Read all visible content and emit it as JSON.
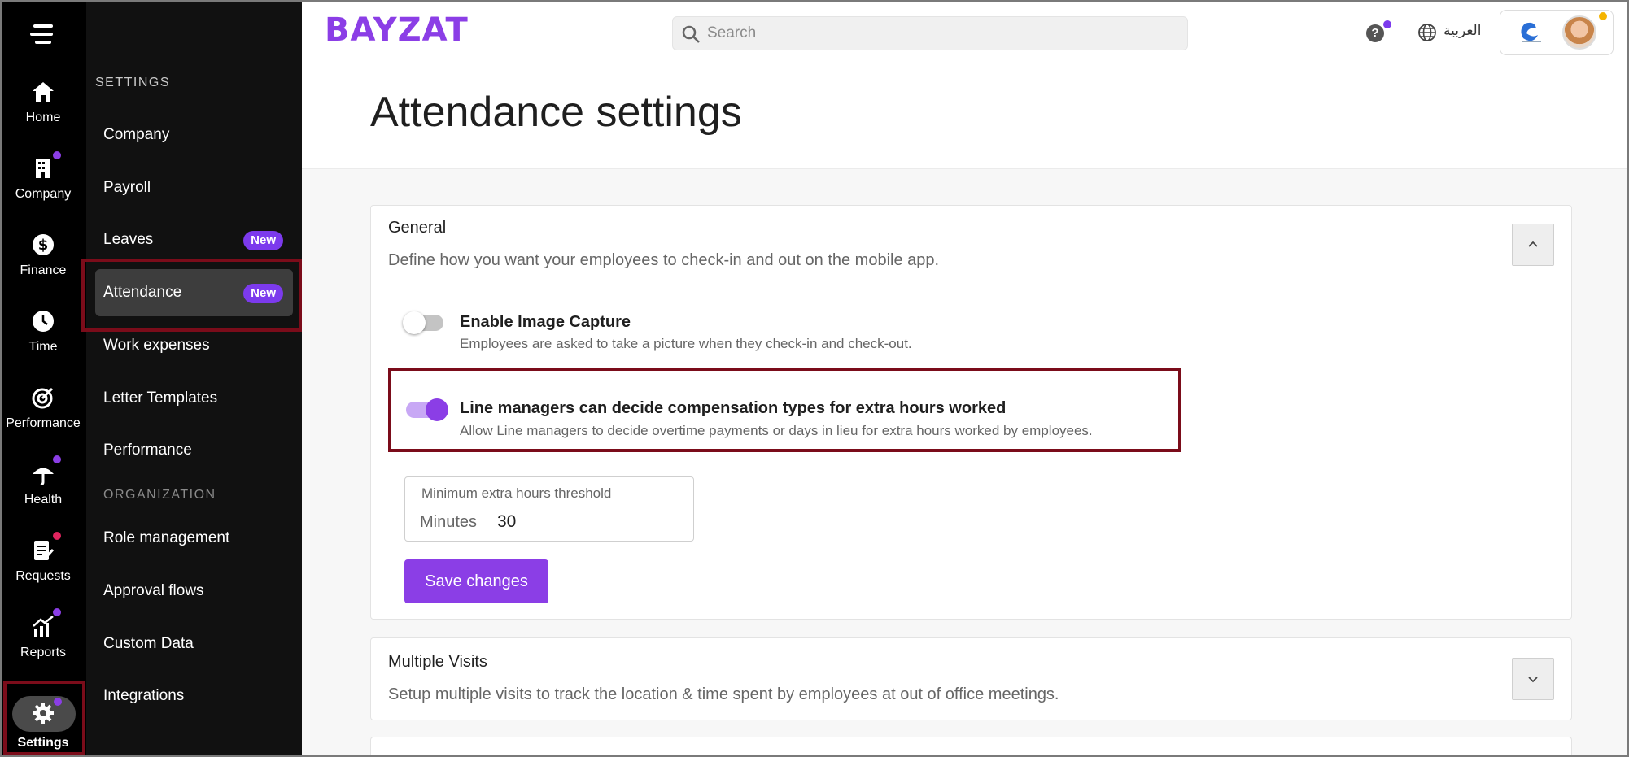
{
  "app": {
    "logo": "BAYZAT"
  },
  "colors": {
    "accent": "#8b3ee6",
    "highlight": "#7b0c1a",
    "rail_bg": "#000000",
    "submenu_bg": "#111111",
    "badge": "#7c3aed"
  },
  "rail": {
    "menu_icon": "hamburger-icon",
    "items": [
      {
        "label": "Home",
        "icon": "home-icon"
      },
      {
        "label": "Company",
        "icon": "building-icon"
      },
      {
        "label": "Finance",
        "icon": "dollar-icon"
      },
      {
        "label": "Time",
        "icon": "clock-icon"
      },
      {
        "label": "Performance",
        "icon": "target-icon"
      },
      {
        "label": "Health",
        "icon": "umbrella-icon"
      },
      {
        "label": "Requests",
        "icon": "request-icon"
      },
      {
        "label": "Reports",
        "icon": "chart-icon"
      },
      {
        "label": "Settings",
        "icon": "gear-icon"
      }
    ]
  },
  "submenu": {
    "heading": "SETTINGS",
    "items": [
      {
        "label": "Company"
      },
      {
        "label": "Payroll"
      },
      {
        "label": "Leaves",
        "badge": "New"
      },
      {
        "label": "Attendance",
        "badge": "New"
      },
      {
        "label": "Work expenses"
      },
      {
        "label": "Letter Templates"
      },
      {
        "label": "Performance"
      }
    ],
    "org_heading": "ORGANIZATION",
    "org_items": [
      {
        "label": "Role management"
      },
      {
        "label": "Approval flows"
      },
      {
        "label": "Custom Data"
      },
      {
        "label": "Integrations"
      }
    ]
  },
  "header": {
    "search_placeholder": "Search",
    "help_icon": "?",
    "language": "العربية"
  },
  "page": {
    "title": "Attendance settings"
  },
  "general": {
    "title": "General",
    "description": "Define how you want your employees to check-in and out on the mobile app.",
    "options": [
      {
        "title": "Enable Image Capture",
        "description": "Employees are asked to take a picture when they check-in and check-out.",
        "enabled": false
      },
      {
        "title": "Line managers can decide compensation types for extra hours worked",
        "description": "Allow Line managers to decide overtime payments or days in lieu for extra hours worked by employees.",
        "enabled": true
      }
    ],
    "threshold": {
      "label": "Minimum extra hours threshold",
      "unit": "Minutes",
      "value": "30"
    },
    "save_label": "Save changes"
  },
  "multiple_visits": {
    "title": "Multiple Visits",
    "description": "Setup multiple visits to track the location & time spent by employees at out of office meetings."
  }
}
